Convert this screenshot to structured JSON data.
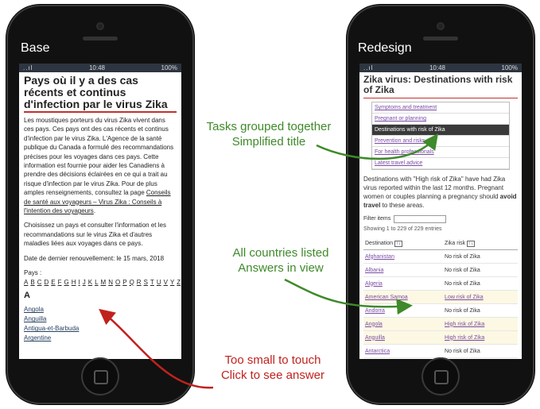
{
  "base_phone": {
    "label": "Base",
    "status": {
      "signal": "..ıl",
      "time": "10:48",
      "battery": "100%"
    },
    "title": "Pays où il y a des cas récents et continus d'infection par le virus Zika",
    "paragraph1_pre": "Les moustiques porteurs du virus Zika vivent dans ces pays. Ces pays ont des cas récents et continus d'infection par le virus Zika. L'Agence de la santé publique du Canada a formulé des recommandations précises pour les voyages dans ces pays. Cette information est fournie pour aider les Canadiens à prendre des décisions éclairées en ce qui a trait au risque d'infection par le virus Zika. Pour de plus amples renseignements, consultez la page ",
    "paragraph1_link": "Conseils de santé aux voyageurs – Virus Zika : Conseils à l'intention des voyageurs",
    "paragraph1_post": ".",
    "paragraph2": "Choisissez un pays et consulter l'information et les recommandations sur le virus Zika et d'autres maladies liées aux voyages dans ce pays.",
    "date": "Date de dernier renouvellement: le 15 mars, 2018",
    "letters_label": "Pays :",
    "letters": [
      "A",
      "B",
      "C",
      "D",
      "E",
      "F",
      "G",
      "H",
      "I",
      "J",
      "K",
      "L",
      "M",
      "N",
      "O",
      "P",
      "Q",
      "R",
      "S",
      "T",
      "U",
      "V",
      "Y",
      "Z"
    ],
    "section_letter": "A",
    "countries": [
      "Angola",
      "Anguilla",
      "Antigua-et-Barbuda",
      "Argentine"
    ]
  },
  "redesign_phone": {
    "label": "Redesign",
    "status": {
      "signal": "..ıl",
      "time": "10:48",
      "battery": "100%"
    },
    "title": "Zika virus: Destinations with risk of Zika",
    "menu": [
      "Symptoms and treatment",
      "Pregnant or planning",
      "Destinations with risk of Zika",
      "Prevention and risks",
      "For health professionals",
      "Latest travel advice"
    ],
    "menu_active_index": 2,
    "intro_pre": "Destinations with \"High risk of Zika\" have had Zika virus reported within the last 12 months. Pregnant women or couples planning a pregnancy should ",
    "intro_bold": "avoid travel",
    "intro_post": " to these areas.",
    "filter_label": "Filter items",
    "entries": "Showing 1 to 229 of 229 entries",
    "columns": [
      "Destination",
      "Zika risk"
    ],
    "rows": [
      {
        "destination": "Afghanistan",
        "risk": "No risk of Zika",
        "level": "none"
      },
      {
        "destination": "Albania",
        "risk": "No risk of Zika",
        "level": "none"
      },
      {
        "destination": "Algeria",
        "risk": "No risk of Zika",
        "level": "none"
      },
      {
        "destination": "American Samoa",
        "risk": "Low risk of Zika",
        "level": "low"
      },
      {
        "destination": "Andorra",
        "risk": "No risk of Zika",
        "level": "none"
      },
      {
        "destination": "Angola",
        "risk": "High risk of Zika",
        "level": "high"
      },
      {
        "destination": "Anguilla",
        "risk": "High risk of Zika",
        "level": "high"
      },
      {
        "destination": "Antarctica",
        "risk": "No risk of Zika",
        "level": "none"
      }
    ]
  },
  "annotations": {
    "tasks": [
      "Tasks grouped together",
      "Simplified title"
    ],
    "countries": [
      "All countries listed",
      "Answers in view"
    ],
    "touch": [
      "Too small to touch",
      "Click to see answer"
    ]
  },
  "colors": {
    "green": "#3f8a2a",
    "red": "#c0221e"
  }
}
